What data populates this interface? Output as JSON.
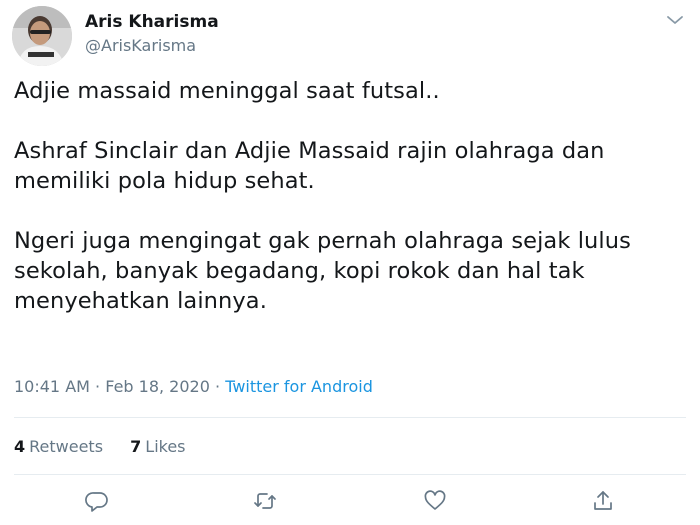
{
  "user": {
    "name": "Aris Kharisma",
    "handle": "@ArisKarisma",
    "avatar_icon": "user-photo-avatar"
  },
  "tweet": {
    "paragraphs": [
      [
        "Adjie massaid meninggal saat futsal.."
      ],
      [
        "Ashraf Sinclair dan Adjie Massaid rajin olahraga dan",
        "memiliki pola hidup sehat."
      ],
      [
        "Ngeri juga mengingat gak pernah olahraga sejak lulus",
        "sekolah, banyak begadang, kopi rokok dan hal tak",
        "menyehatkan lainnya."
      ]
    ]
  },
  "meta": {
    "time": "10:41 AM",
    "separator": "·",
    "date": "Feb 18, 2020",
    "source": "Twitter for Android"
  },
  "stats": {
    "retweets_count": "4",
    "retweets_label": "Retweets",
    "likes_count": "7",
    "likes_label": "Likes"
  },
  "actions": {
    "icons": [
      "reply-icon",
      "retweet-icon",
      "like-icon",
      "share-icon"
    ]
  },
  "colors": {
    "text": "#14171a",
    "secondary": "#657786",
    "link": "#1b95e0",
    "divider": "#e6ecf0"
  }
}
